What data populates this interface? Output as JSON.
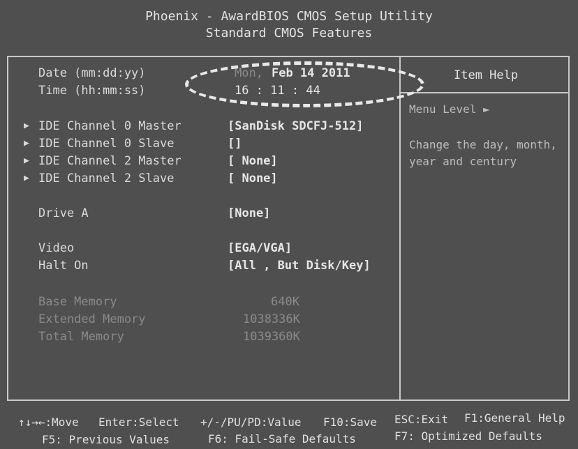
{
  "header": {
    "title": "Phoenix - AwardBIOS CMOS Setup Utility",
    "subtitle": "Standard CMOS Features"
  },
  "settings": {
    "date": {
      "label": "Date (mm:dd:yy)",
      "day": "Mon,",
      "value": "Feb 14 2011"
    },
    "time": {
      "label": "Time (hh:mm:ss)",
      "value": "16 : 11 : 44"
    },
    "ide0_master": {
      "label": "IDE Channel 0 Master",
      "value": "[SanDisk SDCFJ-512]"
    },
    "ide0_slave": {
      "label": "IDE Channel 0 Slave",
      "value": "[]"
    },
    "ide2_master": {
      "label": "IDE Channel 2 Master",
      "value": "[ None]"
    },
    "ide2_slave": {
      "label": "IDE Channel 2 Slave",
      "value": "[ None]"
    },
    "drive_a": {
      "label": "Drive A",
      "value": "[None]"
    },
    "video": {
      "label": "Video",
      "value": "[EGA/VGA]"
    },
    "halt_on": {
      "label": "Halt On",
      "value": "[All , But Disk/Key]"
    },
    "base_memory": {
      "label": "Base Memory",
      "value": "640K"
    },
    "extended_memory": {
      "label": "Extended Memory",
      "value": "1038336K"
    },
    "total_memory": {
      "label": "Total Memory",
      "value": "1039360K"
    }
  },
  "help": {
    "title": "Item Help",
    "menu_level": "Menu Level  ►",
    "line1": "Change the day, month,",
    "line2": "year and century"
  },
  "footer": {
    "move": "↑↓→←:Move",
    "enter": "Enter:Select",
    "value": "+/-/PU/PD:Value",
    "f10": "F10:Save",
    "esc": "ESC:Exit",
    "f1": "F1:General Help",
    "f5": "F5: Previous Values",
    "f6": "F6: Fail-Safe Defaults",
    "f7": "F7: Optimized Defaults"
  },
  "icons": {
    "submenu_arrow": "triangle-right-icon",
    "menu_level_arrow": "triangle-right-icon"
  }
}
